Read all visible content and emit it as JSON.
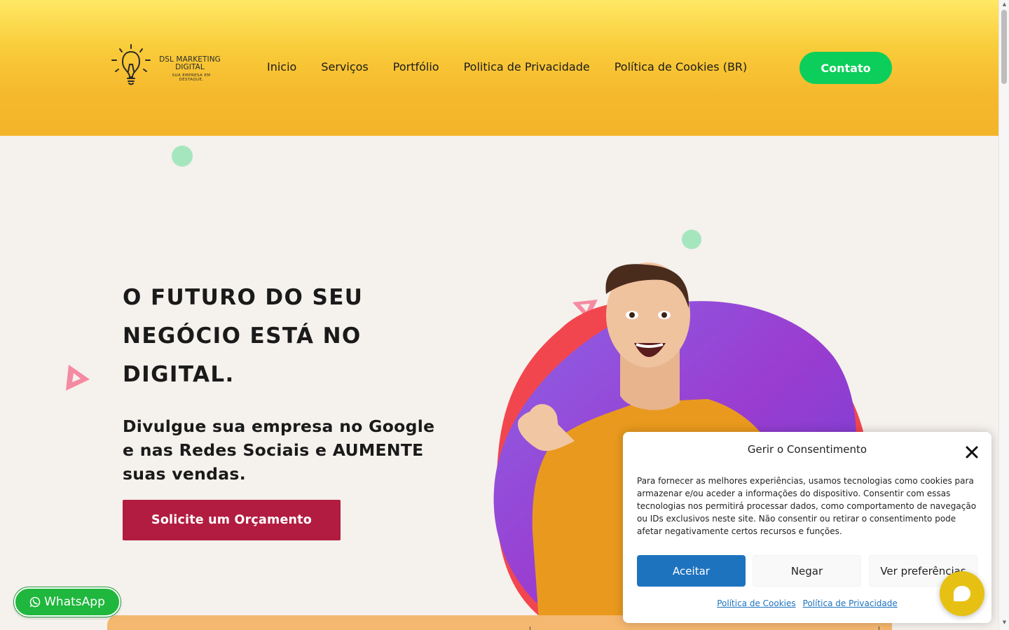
{
  "header": {
    "logo": {
      "name": "DSL MARKETING DIGITAL",
      "tagline": "SUA EMPRESA EM DESTAQUE."
    },
    "nav": [
      {
        "label": "Inicio"
      },
      {
        "label": "Serviços"
      },
      {
        "label": "Portfólio"
      },
      {
        "label": "Politica de Privacidade"
      },
      {
        "label": "Política de Cookies (BR)"
      }
    ],
    "contact_label": "Contato"
  },
  "hero": {
    "title": "O FUTURO DO SEU NEGÓCIO ESTÁ NO DIGITAL.",
    "subtitle": "Divulgue sua empresa no Google e nas Redes Sociais e AUMENTE suas vendas.",
    "cta_label": "Solicite um Orçamento"
  },
  "whatsapp": {
    "label": "WhatsApp"
  },
  "consent": {
    "title": "Gerir o Consentimento",
    "text": "Para fornecer as melhores experiências, usamos tecnologias como cookies para armazenar e/ou aceder a informações do dispositivo. Consentir com essas tecnologias nos permitirá processar dados, como comportamento de navegação ou IDs exclusivos neste site. Não consentir ou retirar o consentimento pode afetar negativamente certos recursos e funções.",
    "accept_label": "Aceitar",
    "deny_label": "Negar",
    "prefs_label": "Ver preferências",
    "links": [
      {
        "label": "Política de Cookies"
      },
      {
        "label": "Política de Privacidade"
      }
    ]
  },
  "colors": {
    "header_top": "#ffe865",
    "header_bottom": "#f4b42a",
    "contact_button": "#0ccf5b",
    "cta_button": "#b21c40",
    "accept_button": "#1e73be",
    "whatsapp": "#1fb73d",
    "chat_bubble": "#e6c113",
    "page_background": "#f5f1ec"
  },
  "icons": {
    "logo": "lightbulb-icon",
    "close": "close-icon",
    "whatsapp": "whatsapp-icon",
    "chat": "chat-bubble-icon"
  }
}
